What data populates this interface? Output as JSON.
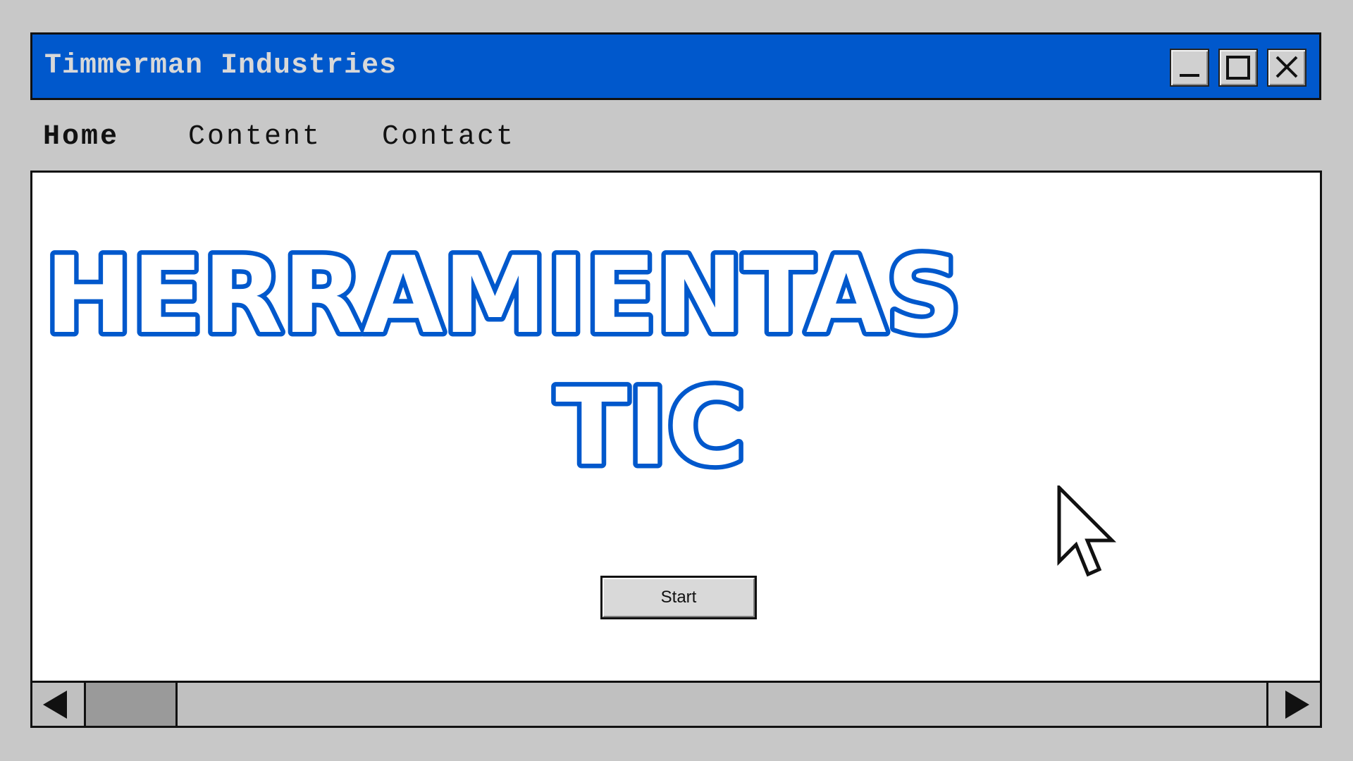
{
  "window": {
    "title": "Timmerman Industries",
    "titlebar_color": "#0058cc",
    "controls": {
      "minimize_icon": "minimize-icon",
      "maximize_icon": "maximize-icon",
      "close_icon": "close-icon"
    }
  },
  "nav": {
    "items": [
      {
        "label": "Home",
        "active": true
      },
      {
        "label": "Content",
        "active": false
      },
      {
        "label": "Contact",
        "active": false
      }
    ]
  },
  "main": {
    "heading_line1": "HERRAMIENTAS",
    "heading_line2": "TIC",
    "heading_color": "#0058cc",
    "start_button_label": "Start",
    "cursor_icon": "mouse-pointer-icon"
  },
  "scrollbar": {
    "left_icon": "arrow-left-icon",
    "right_icon": "arrow-right-icon"
  }
}
